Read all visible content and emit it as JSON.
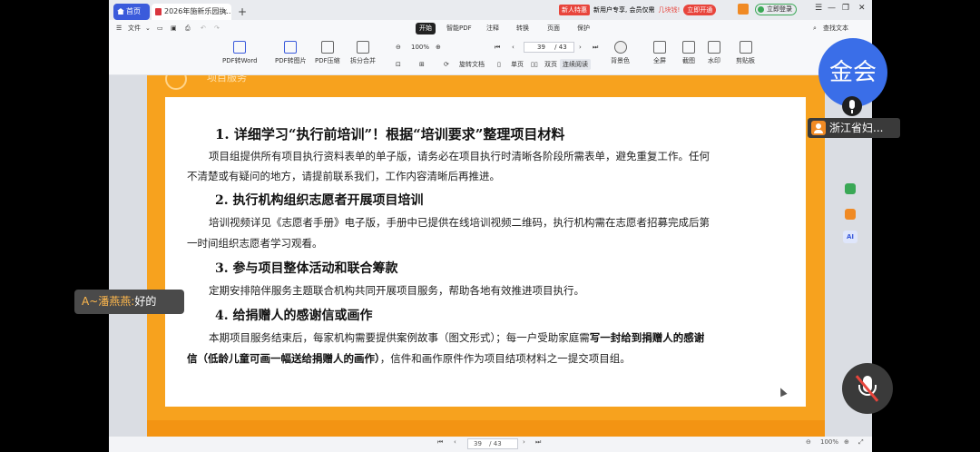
{
  "tabs": {
    "home": "首页",
    "doc": "2026年施新乐园执...",
    "close": "×",
    "plus": "+"
  },
  "promo": {
    "badge": "新人特惠",
    "text": "新用户专享, 会员仅需",
    "highlight": "几块钱!",
    "button": "立即开通"
  },
  "login": "立即登录",
  "window_controls": [
    "☰",
    "—",
    "❐",
    "✕"
  ],
  "menu": {
    "file": "文件",
    "items": [
      "开始",
      "智能PDF",
      "注释",
      "转换",
      "页面",
      "保护"
    ],
    "search": "查找文本"
  },
  "toolbar": {
    "pdf_to_word": "PDF转Word",
    "pdf_to_image": "PDF转图片",
    "pdf_compress": "PDF压缩",
    "split_merge": "拆分合并",
    "zoom": "100%",
    "page_current": "39",
    "page_total": "/ 43",
    "rotate": "旋转文档",
    "single": "单页",
    "double": "双页",
    "continuous": "连续阅读",
    "bg_color": "背景色",
    "fullscreen": "全屏",
    "screenshot": "截图",
    "watermark": "水印",
    "clip": "剪贴板"
  },
  "slide": {
    "header": "项目服务",
    "h1": "1. 详细学习“执行前培训”！根据“培训要求”整理项目材料",
    "p1a": "项目组提供所有项目执行资料表单的单子版，请务必在项目执行时清晰各阶段所需表单，避免重复工作。任何",
    "p1b": "不清楚或有疑问的地方，请提前联系我们，工作内容清晰后再推进。",
    "h2": "2. 执行机构组织志愿者开展项目培训",
    "p2a": "培训视频详见《志愿者手册》电子版，手册中已提供在线培训视频二维码，执行机构需在志愿者招募完成后第",
    "p2b": "一时间组织志愿者学习观看。",
    "h3": "3. 参与项目整体活动和联合筹款",
    "p3": "定期安排陪伴服务主题联合机构共同开展项目服务，帮助各地有效推进项目执行。",
    "h4": "4. 给捐赠人的感谢信或画作",
    "p4a": "本期项目服务结束后，每家机构需要提供案例故事（图文形式）；每一户受助家庭需",
    "p4a_bold": "写一封给到捐赠人的感谢",
    "p4b_bold": "信（低龄儿童可画一幅送给捐赠人的画作）",
    "p4b": "，信件和画作原件作为项目结项材料之一提交项目组。"
  },
  "status": {
    "page": "39",
    "total": "/ 43",
    "zoom": "100%"
  },
  "meeting": {
    "avatar": "金会",
    "participant": "浙江省妇...",
    "chat_who": "A~潘燕燕:",
    "chat_msg": "好的"
  }
}
